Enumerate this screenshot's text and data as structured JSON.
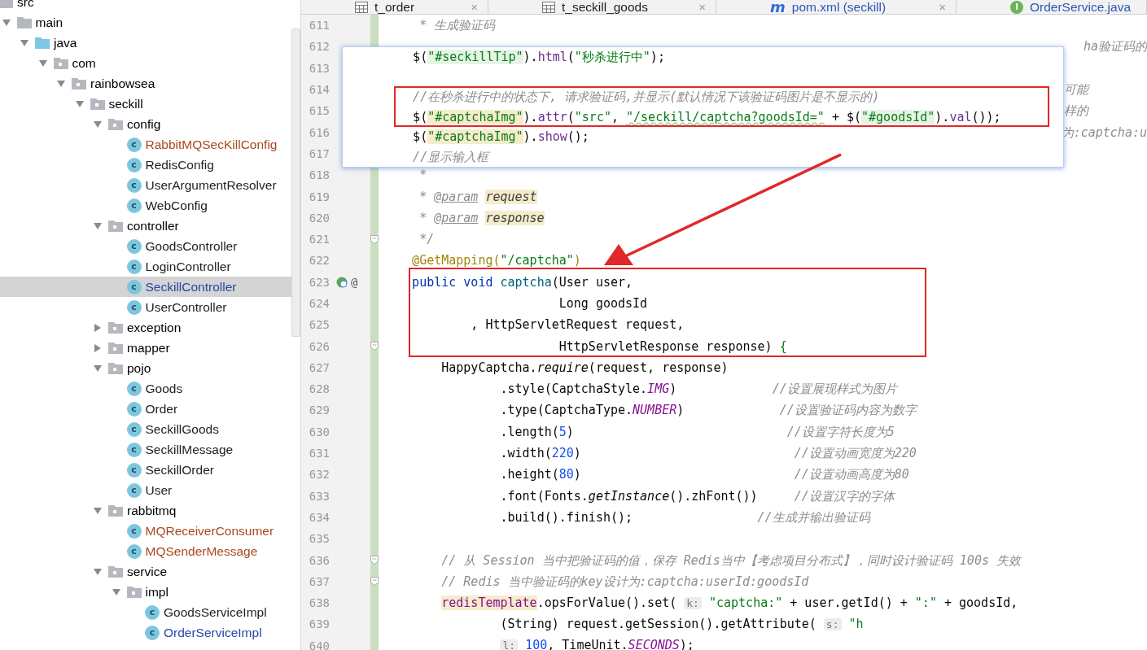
{
  "tree": {
    "items": [
      {
        "kind": "folder",
        "label": "src",
        "selected": false,
        "children": [
          {
            "kind": "folder",
            "label": "main",
            "expanded": true,
            "selected": false,
            "children": [
              {
                "kind": "source-folder",
                "label": "java",
                "expanded": true,
                "selected": false,
                "children": [
                  {
                    "kind": "package",
                    "label": "com",
                    "expanded": true,
                    "selected": false,
                    "children": [
                      {
                        "kind": "package",
                        "label": "rainbowsea",
                        "expanded": true,
                        "selected": false,
                        "children": [
                          {
                            "kind": "package",
                            "label": "seckill",
                            "expanded": true,
                            "selected": false,
                            "children": [
                              {
                                "kind": "package",
                                "label": "config",
                                "expanded": true,
                                "selected": false,
                                "children": [
                                  {
                                    "kind": "class",
                                    "label": "RabbitMQSecKillConfig",
                                    "icon_letter": "c",
                                    "color": "#a8481c",
                                    "selected": false
                                  },
                                  {
                                    "kind": "class",
                                    "label": "RedisConfig",
                                    "icon_letter": "c",
                                    "color": "#1e1e1e",
                                    "selected": false
                                  },
                                  {
                                    "kind": "class",
                                    "label": "UserArgumentResolver",
                                    "icon_letter": "c",
                                    "color": "#1e1e1e",
                                    "selected": false
                                  },
                                  {
                                    "kind": "class",
                                    "label": "WebConfig",
                                    "icon_letter": "c",
                                    "color": "#1e1e1e",
                                    "selected": false
                                  }
                                ]
                              },
                              {
                                "kind": "package",
                                "label": "controller",
                                "expanded": true,
                                "selected": false,
                                "children": [
                                  {
                                    "kind": "class",
                                    "label": "GoodsController",
                                    "icon_letter": "c",
                                    "color": "#1e1e1e",
                                    "selected": false
                                  },
                                  {
                                    "kind": "class",
                                    "label": "LoginController",
                                    "icon_letter": "c",
                                    "color": "#1e1e1e",
                                    "selected": false
                                  },
                                  {
                                    "kind": "class",
                                    "label": "SeckillController",
                                    "icon_letter": "c",
                                    "color": "#2548a8",
                                    "selected": true
                                  },
                                  {
                                    "kind": "class",
                                    "label": "UserController",
                                    "icon_letter": "c",
                                    "color": "#1e1e1e",
                                    "selected": false
                                  }
                                ]
                              },
                              {
                                "kind": "package",
                                "label": "exception",
                                "expanded": false,
                                "selected": false
                              },
                              {
                                "kind": "package",
                                "label": "mapper",
                                "expanded": false,
                                "selected": false
                              },
                              {
                                "kind": "package",
                                "label": "pojo",
                                "expanded": true,
                                "selected": false,
                                "children": [
                                  {
                                    "kind": "class",
                                    "label": "Goods",
                                    "icon_letter": "c",
                                    "color": "#1e1e1e",
                                    "selected": false
                                  },
                                  {
                                    "kind": "class",
                                    "label": "Order",
                                    "icon_letter": "c",
                                    "color": "#1e1e1e",
                                    "selected": false
                                  },
                                  {
                                    "kind": "class",
                                    "label": "SeckillGoods",
                                    "icon_letter": "c",
                                    "color": "#1e1e1e",
                                    "selected": false
                                  },
                                  {
                                    "kind": "class",
                                    "label": "SeckillMessage",
                                    "icon_letter": "c",
                                    "color": "#1e1e1e",
                                    "selected": false
                                  },
                                  {
                                    "kind": "class",
                                    "label": "SeckillOrder",
                                    "icon_letter": "c",
                                    "color": "#1e1e1e",
                                    "selected": false
                                  },
                                  {
                                    "kind": "class",
                                    "label": "User",
                                    "icon_letter": "c",
                                    "color": "#1e1e1e",
                                    "selected": false
                                  }
                                ]
                              },
                              {
                                "kind": "package",
                                "label": "rabbitmq",
                                "expanded": true,
                                "selected": false,
                                "children": [
                                  {
                                    "kind": "class",
                                    "label": "MQReceiverConsumer",
                                    "icon_letter": "c",
                                    "color": "#a8481c",
                                    "selected": false
                                  },
                                  {
                                    "kind": "class",
                                    "label": "MQSenderMessage",
                                    "icon_letter": "c",
                                    "color": "#a8481c",
                                    "selected": false
                                  }
                                ]
                              },
                              {
                                "kind": "package",
                                "label": "service",
                                "expanded": true,
                                "selected": false,
                                "children": [
                                  {
                                    "kind": "package",
                                    "label": "impl",
                                    "expanded": true,
                                    "selected": false,
                                    "children": [
                                      {
                                        "kind": "class",
                                        "label": "GoodsServiceImpl",
                                        "icon_letter": "c",
                                        "color": "#1e1e1e",
                                        "selected": false
                                      },
                                      {
                                        "kind": "class",
                                        "label": "OrderServiceImpl",
                                        "icon_letter": "c",
                                        "color": "#2548a8",
                                        "selected": false
                                      }
                                    ]
                                  }
                                ]
                              }
                            ]
                          }
                        ]
                      }
                    ]
                  }
                ]
              }
            ]
          }
        ]
      }
    ]
  },
  "tabs": [
    {
      "label": "t_order",
      "kind": "table",
      "color": "#1e1e1e",
      "close": "×"
    },
    {
      "label": "t_seckill_goods",
      "kind": "table",
      "color": "#1e1e1e",
      "close": "×"
    },
    {
      "label": "pom.xml (seckill)",
      "kind": "maven",
      "icon_letter": "m",
      "color": "#2a56b8",
      "close": "×"
    },
    {
      "label": "OrderService.java",
      "kind": "interface",
      "icon_letter": "I",
      "color": "#2a56b8"
    }
  ],
  "editor": {
    "lines": [
      {
        "number": "611",
        "kind": "code",
        "fold": false,
        "tokens": [
          {
            "kind": "cm",
            "text": "     * 生成验证码"
          }
        ]
      },
      {
        "number": "612",
        "kind": "tail-edge",
        "fold": false,
        "tokens": [
          {
            "kind": "cm",
            "text": "ha验证码的"
          }
        ]
      },
      {
        "number": "613",
        "fold": false
      },
      {
        "number": "614",
        "kind": "tail",
        "fold": false,
        "tokens": [
          {
            "kind": "cm",
            "text": "可能"
          }
        ]
      },
      {
        "number": "615",
        "kind": "tail",
        "fold": false,
        "tokens": [
          {
            "kind": "cm",
            "text": "样的"
          }
        ]
      },
      {
        "number": "616",
        "kind": "tail-edge",
        "fold": false,
        "tokens": [
          {
            "kind": "cm",
            "text": "为:captcha:u"
          }
        ]
      },
      {
        "number": "617",
        "fold": false
      },
      {
        "number": "618",
        "kind": "code",
        "fold": false,
        "tokens": [
          {
            "kind": "cm",
            "text": "     *"
          }
        ]
      },
      {
        "number": "619",
        "kind": "code",
        "fold": false,
        "tokens": [
          {
            "kind": "cm",
            "text": "     * "
          },
          {
            "kind": "tag",
            "text": "@param"
          },
          {
            "kind": "dp",
            "text": "request"
          }
        ]
      },
      {
        "number": "620",
        "kind": "code",
        "fold": false,
        "tokens": [
          {
            "kind": "cm",
            "text": "     * "
          },
          {
            "kind": "tag",
            "text": "@param"
          },
          {
            "kind": "dp",
            "text": "response"
          }
        ]
      },
      {
        "number": "621",
        "kind": "code",
        "fold": true,
        "tokens": [
          {
            "kind": "cm",
            "text": "     */"
          }
        ]
      },
      {
        "number": "622",
        "kind": "code",
        "fold": false,
        "tokens": [
          {
            "kind": "ann",
            "text": "    @GetMapping("
          },
          {
            "kind": "str",
            "text": "\"/captcha\""
          },
          {
            "kind": "ann",
            "text": ")"
          }
        ]
      },
      {
        "number": "623",
        "kind": "code",
        "fold": false,
        "run_marker": true,
        "gutter_text": "@",
        "tokens": [
          {
            "kind": "kw",
            "text": "    public void"
          },
          {
            "kind": "fn",
            "text": " captcha"
          },
          {
            "kind": "p",
            "text": "(User user,"
          }
        ]
      },
      {
        "number": "624",
        "kind": "code",
        "fold": false,
        "tokens": [
          {
            "kind": "p",
            "text": "                        Long goodsId"
          }
        ]
      },
      {
        "number": "625",
        "kind": "code",
        "fold": false,
        "tokens": [
          {
            "kind": "p",
            "text": "            , HttpServletRequest request,"
          }
        ]
      },
      {
        "number": "626",
        "kind": "code",
        "fold": true,
        "tokens": [
          {
            "kind": "p",
            "text": "                        HttpServletResponse response) "
          },
          {
            "kind": "br",
            "text": "{"
          }
        ]
      },
      {
        "number": "627",
        "kind": "code",
        "fold": false,
        "tokens": [
          {
            "kind": "p",
            "text": "        HappyCaptcha."
          },
          {
            "kind": "sm",
            "text": "require"
          },
          {
            "kind": "p",
            "text": "(request, response)"
          }
        ]
      },
      {
        "number": "628",
        "kind": "code",
        "fold": false,
        "tokens": [
          {
            "kind": "p",
            "text": "                .style(CaptchaStyle."
          },
          {
            "kind": "sf",
            "text": "IMG"
          },
          {
            "kind": "p",
            "text": ")"
          },
          {
            "kind": "cm",
            "text": "             //设置展现样式为图片"
          }
        ]
      },
      {
        "number": "629",
        "kind": "code",
        "fold": false,
        "tokens": [
          {
            "kind": "p",
            "text": "                .type(CaptchaType."
          },
          {
            "kind": "sf",
            "text": "NUMBER"
          },
          {
            "kind": "p",
            "text": ")"
          },
          {
            "kind": "cm",
            "text": "             //设置验证码内容为数字"
          }
        ]
      },
      {
        "number": "630",
        "kind": "code",
        "fold": false,
        "tokens": [
          {
            "kind": "p",
            "text": "                .length("
          },
          {
            "kind": "num",
            "text": "5"
          },
          {
            "kind": "p",
            "text": ")"
          },
          {
            "kind": "cm",
            "text": "                             //设置字符长度为5"
          }
        ]
      },
      {
        "number": "631",
        "kind": "code",
        "fold": false,
        "tokens": [
          {
            "kind": "p",
            "text": "                .width("
          },
          {
            "kind": "num",
            "text": "220"
          },
          {
            "kind": "p",
            "text": ")"
          },
          {
            "kind": "cm",
            "text": "                             //设置动画宽度为220"
          }
        ]
      },
      {
        "number": "632",
        "kind": "code",
        "fold": false,
        "tokens": [
          {
            "kind": "p",
            "text": "                .height("
          },
          {
            "kind": "num",
            "text": "80"
          },
          {
            "kind": "p",
            "text": ")"
          },
          {
            "kind": "cm",
            "text": "                             //设置动画高度为80"
          }
        ]
      },
      {
        "number": "633",
        "kind": "code",
        "fold": false,
        "tokens": [
          {
            "kind": "p",
            "text": "                .font(Fonts."
          },
          {
            "kind": "sm",
            "text": "getInstance"
          },
          {
            "kind": "p",
            "text": "().zhFont())"
          },
          {
            "kind": "cm",
            "text": "     //设置汉字的字体"
          }
        ]
      },
      {
        "number": "634",
        "kind": "code",
        "fold": false,
        "tokens": [
          {
            "kind": "p",
            "text": "                .build().finish();"
          },
          {
            "kind": "cm",
            "text": "                 //生成并输出验证码"
          }
        ]
      },
      {
        "number": "635",
        "fold": false
      },
      {
        "number": "636",
        "kind": "code",
        "fold": true,
        "tokens": [
          {
            "kind": "cm",
            "text": "        // 从 Session 当中把验证码的值，保存 Redis当中【考虑项目分布式】，同时设计验证码 100s 失效"
          }
        ]
      },
      {
        "number": "637",
        "kind": "code",
        "fold": true,
        "tokens": [
          {
            "kind": "cm",
            "text": "        // Redis 当中验证码的key设计为:captcha:userId:goodsId"
          }
        ]
      },
      {
        "number": "638",
        "kind": "code",
        "fold": false,
        "tokens": [
          {
            "kind": "fld",
            "text": "        redisTemplate"
          },
          {
            "kind": "p",
            "text": ".opsForValue().set( "
          },
          {
            "kind": "hint",
            "text": "k:"
          },
          {
            "kind": "str",
            "text": " \"captcha:\""
          },
          {
            "kind": "p",
            "text": " + user.getId() + "
          },
          {
            "kind": "str",
            "text": "\":\""
          },
          {
            "kind": "p",
            "text": " + goodsId,"
          }
        ]
      },
      {
        "number": "639",
        "kind": "code",
        "fold": false,
        "tokens": [
          {
            "kind": "p",
            "text": "                (String) request.getSession().getAttribute( "
          },
          {
            "kind": "hint",
            "text": "s:"
          },
          {
            "kind": "str",
            "text": " \"h"
          }
        ]
      },
      {
        "number": "640",
        "kind": "code",
        "fold": false,
        "tokens": [
          {
            "kind": "hint",
            "text": "                l:"
          },
          {
            "kind": "num",
            "text": " 100"
          },
          {
            "kind": "p",
            "text": ", TimeUnit."
          },
          {
            "kind": "sf",
            "text": "SECONDS"
          },
          {
            "kind": "p",
            "text": ");"
          }
        ]
      }
    ]
  },
  "popup": {
    "lines": [
      {
        "kind": "code",
        "tokens": [
          {
            "kind": "p",
            "text": "    $("
          },
          {
            "kind": "sel",
            "text": "\"#seckillTip\""
          },
          {
            "kind": "p",
            "text": ")."
          },
          {
            "kind": "jq",
            "text": "html"
          },
          {
            "kind": "p",
            "text": "("
          },
          {
            "kind": "str",
            "text": "\"秒杀进行中\""
          },
          {
            "kind": "p",
            "text": ");"
          }
        ]
      },
      {
        "kind": "blank"
      },
      {
        "kind": "code",
        "tokens": [
          {
            "kind": "cm",
            "text": "    //在秒杀进行中的状态下, 请求验证码,并显示(默认情况下该验证码图片是不显示的)"
          }
        ]
      },
      {
        "kind": "code",
        "tokens": [
          {
            "kind": "p",
            "text": "    $("
          },
          {
            "kind": "selw",
            "text": "\"#captchaImg\""
          },
          {
            "kind": "p",
            "text": ")."
          },
          {
            "kind": "jq",
            "text": "attr"
          },
          {
            "kind": "p",
            "text": "("
          },
          {
            "kind": "str",
            "text": "\"src\""
          },
          {
            "kind": "p",
            "text": ", "
          },
          {
            "kind": "url",
            "text": "\"/seckill/captcha?goodsId=\""
          },
          {
            "kind": "p",
            "text": " + $("
          },
          {
            "kind": "sel",
            "text": "\"#goodsId\""
          },
          {
            "kind": "p",
            "text": ")."
          },
          {
            "kind": "jq",
            "text": "val"
          },
          {
            "kind": "p",
            "text": "());"
          }
        ]
      },
      {
        "kind": "code",
        "tokens": [
          {
            "kind": "p",
            "text": "    $("
          },
          {
            "kind": "selw",
            "text": "\"#captchaImg\""
          },
          {
            "kind": "p",
            "text": ")."
          },
          {
            "kind": "jq",
            "text": "show"
          },
          {
            "kind": "p",
            "text": "();"
          }
        ]
      },
      {
        "kind": "code",
        "tokens": [
          {
            "kind": "cm",
            "text": "    //显示输入框"
          }
        ]
      }
    ]
  }
}
